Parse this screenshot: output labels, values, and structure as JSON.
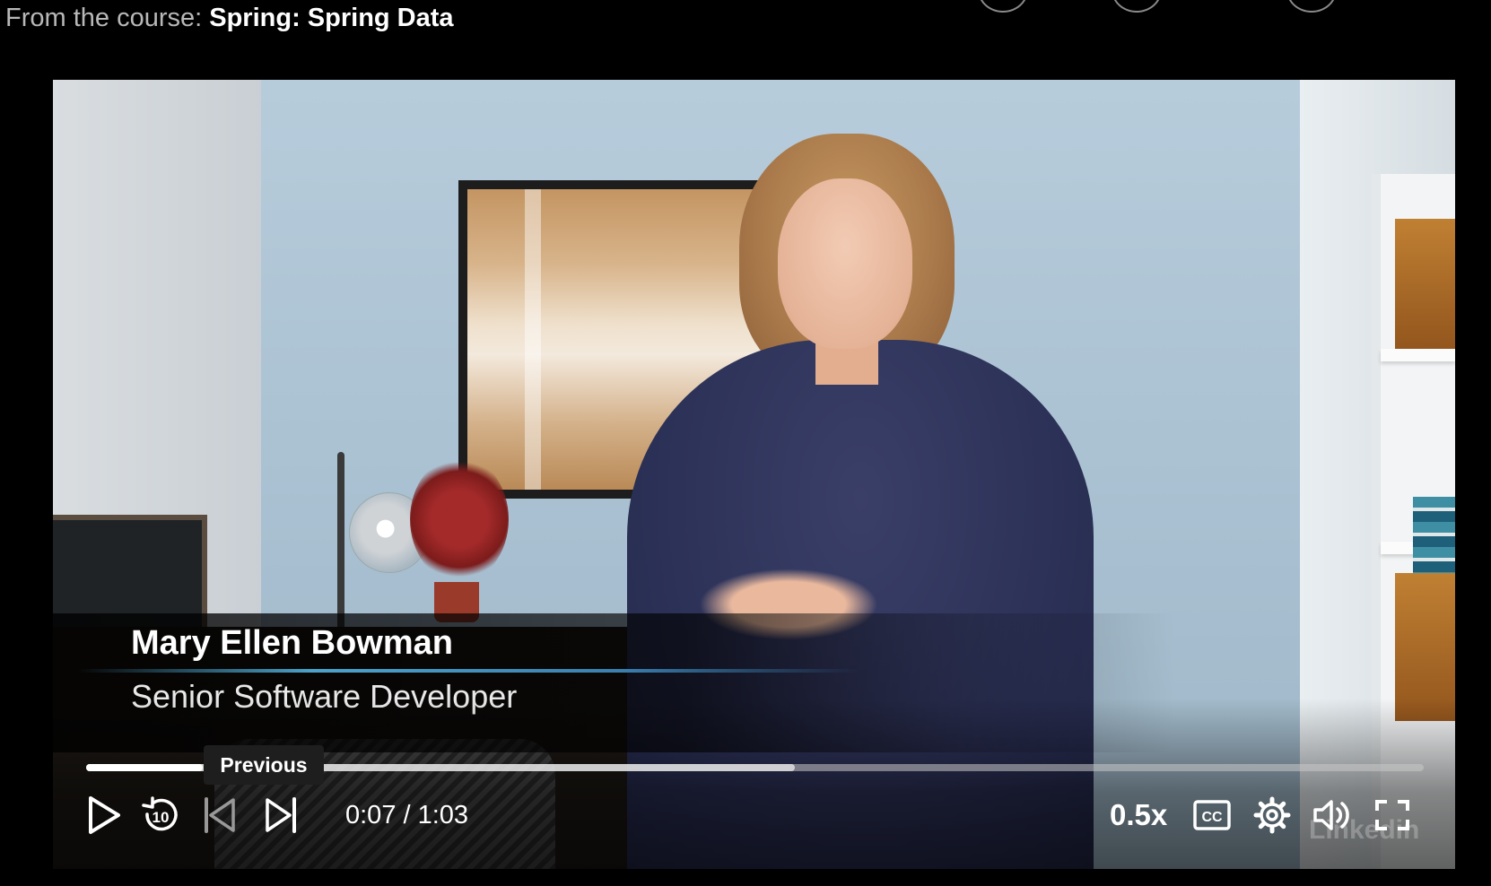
{
  "header": {
    "prefix": "From the course:",
    "course_title": "Spring: Spring Data"
  },
  "video": {
    "lower_third": {
      "name": "Mary Ellen Bowman",
      "title": "Senior Software Developer"
    },
    "watermark": "Linkedin"
  },
  "controls": {
    "play_icon": "play-icon",
    "rewind_icon": "rewind-10-icon",
    "previous_icon": "skip-previous-icon",
    "next_icon": "skip-next-icon",
    "current_time": "0:07",
    "duration": "1:03",
    "time_display": "0:07 / 1:03",
    "progress_played": 0.087,
    "progress_buffered": 0.53,
    "tooltip": "Previous",
    "speed": "0.5x",
    "captions_icon": "cc-icon",
    "settings_icon": "gear-icon",
    "volume_icon": "volume-icon",
    "fullscreen_icon": "fullscreen-icon"
  },
  "colors": {
    "background": "#000000",
    "accent_line": "#4aa3cc",
    "control_text": "#ffffff"
  }
}
